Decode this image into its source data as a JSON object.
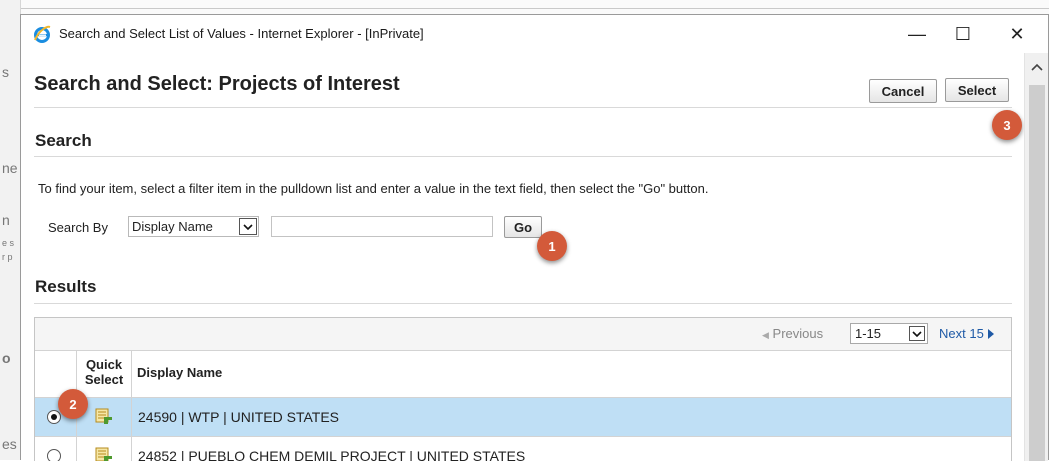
{
  "background": {
    "fragments": [
      "s",
      "ne",
      "n",
      "e s",
      "r p",
      "o",
      "es"
    ]
  },
  "window": {
    "title": "Search and Select List of Values - Internet Explorer - [InPrivate]",
    "controls": {
      "minimize": "—",
      "maximize": "☐",
      "close": "✕"
    }
  },
  "page": {
    "title": "Search and Select: Projects of Interest",
    "cancel_label": "Cancel",
    "select_label": "Select"
  },
  "search": {
    "heading": "Search",
    "instructions": "To find your item, select a filter item in the pulldown list and enter a value in the text field, then select the \"Go\" button.",
    "search_by_label": "Search By",
    "filter_value": "Display Name",
    "text_value": "",
    "go_label": "Go"
  },
  "results": {
    "heading": "Results",
    "previous_label": "Previous",
    "range_value": "1-15",
    "next_label": "Next 15",
    "columns": {
      "quick_select": "Quick Select",
      "display_name": "Display Name"
    },
    "rows": [
      {
        "display_name": "24590 | WTP | UNITED STATES",
        "selected": true
      },
      {
        "display_name": "24852 | PUEBLO CHEM DEMIL PROJECT | UNITED STATES",
        "selected": false
      }
    ]
  },
  "callouts": {
    "go": "1",
    "radio": "2",
    "select": "3"
  },
  "colors": {
    "callout": "#d35a3a",
    "selected_row": "#bfdff5",
    "link": "#1f5aa6"
  }
}
